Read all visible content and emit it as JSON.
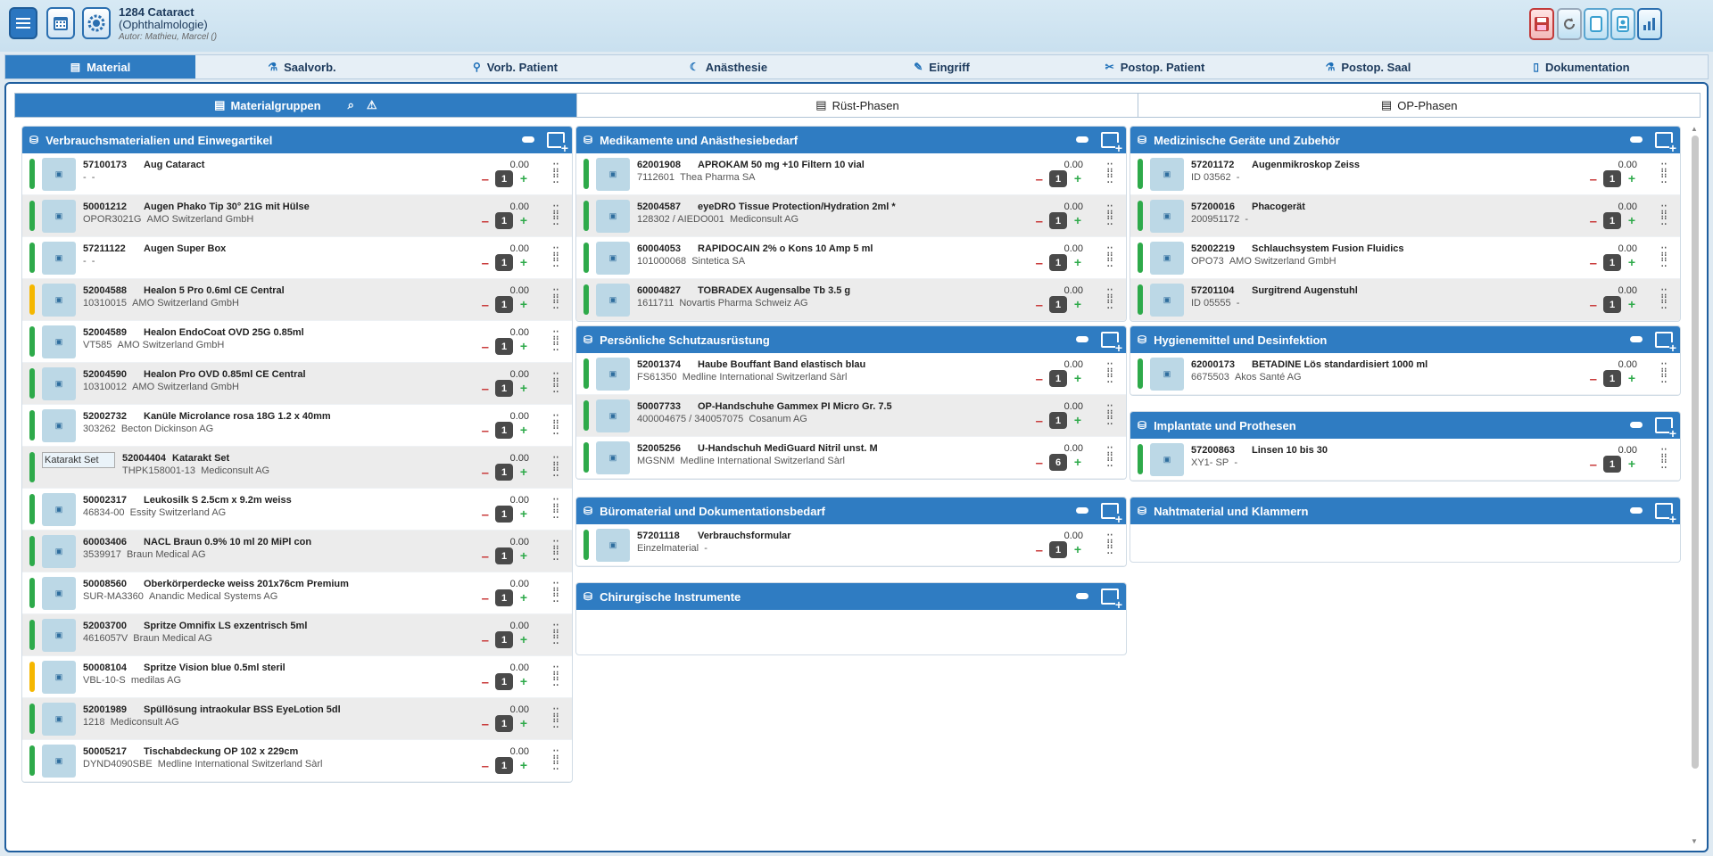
{
  "header": {
    "case_title": "1284 Cataract",
    "department": "(Ophthalmologie)",
    "author": "Autor: Mathieu, Marcel ()"
  },
  "main_tabs": [
    {
      "label": "Material",
      "icon": "archive-icon"
    },
    {
      "label": "Saalvorb.",
      "icon": "room-prep-icon"
    },
    {
      "label": "Vorb. Patient",
      "icon": "patient-prep-icon"
    },
    {
      "label": "Anästhesie",
      "icon": "moon-icon"
    },
    {
      "label": "Eingriff",
      "icon": "scalpel-icon"
    },
    {
      "label": "Postop. Patient",
      "icon": "tools-icon"
    },
    {
      "label": "Postop. Saal",
      "icon": "flask-icon"
    },
    {
      "label": "Dokumentation",
      "icon": "document-icon"
    }
  ],
  "sub_tabs": [
    {
      "label": "Materialgruppen"
    },
    {
      "label": "Rüst-Phasen"
    },
    {
      "label": "OP-Phasen"
    }
  ],
  "panels": {
    "verbrauch": {
      "title": "Verbrauchsmaterialien und Einwegartikel",
      "items": [
        {
          "code": "57100173",
          "name": "Aug Cataract",
          "ref": "-",
          "vendor": "-",
          "amount": "0.00",
          "qty": "1",
          "status": "green"
        },
        {
          "code": "50001212",
          "name": "Augen Phako Tip 30° 21G mit Hülse",
          "ref": "OPOR3021G",
          "vendor": "AMO Switzerland GmbH",
          "amount": "0.00",
          "qty": "1",
          "status": "green"
        },
        {
          "code": "57211122",
          "name": "Augen Super Box",
          "ref": "-",
          "vendor": "-",
          "amount": "0.00",
          "qty": "1",
          "status": "green"
        },
        {
          "code": "52004588",
          "name": "Healon 5 Pro 0.6ml CE Central",
          "ref": "10310015",
          "vendor": "AMO Switzerland GmbH",
          "amount": "0.00",
          "qty": "1",
          "status": "yellow"
        },
        {
          "code": "52004589",
          "name": "Healon EndoCoat OVD 25G 0.85ml",
          "ref": "VT585",
          "vendor": "AMO Switzerland GmbH",
          "amount": "0.00",
          "qty": "1",
          "status": "green"
        },
        {
          "code": "52004590",
          "name": "Healon Pro OVD 0.85ml CE Central",
          "ref": "10310012",
          "vendor": "AMO Switzerland GmbH",
          "amount": "0.00",
          "qty": "1",
          "status": "green"
        },
        {
          "code": "52002732",
          "name": "Kanüle Microlance rosa 18G 1.2 x 40mm",
          "ref": "303262",
          "vendor": "Becton Dickinson AG",
          "amount": "0.00",
          "qty": "1",
          "status": "green"
        },
        {
          "code": "52004404",
          "name": "Katarakt Set",
          "ref": "THPK158001-13",
          "vendor": "Mediconsult AG",
          "amount": "0.00",
          "qty": "1",
          "status": "green",
          "img_alt": "Katarakt Set"
        },
        {
          "code": "50002317",
          "name": "Leukosilk S 2.5cm x 9.2m weiss",
          "ref": "46834-00",
          "vendor": "Essity Switzerland AG",
          "amount": "0.00",
          "qty": "1",
          "status": "green"
        },
        {
          "code": "60003406",
          "name": "NACL Braun 0.9% 10 ml 20 MiPl con",
          "ref": "3539917",
          "vendor": "Braun Medical AG",
          "amount": "0.00",
          "qty": "1",
          "status": "green"
        },
        {
          "code": "50008560",
          "name": "Oberkörperdecke weiss 201x76cm Premium",
          "ref": "SUR-MA3360",
          "vendor": "Anandic Medical Systems AG",
          "amount": "0.00",
          "qty": "1",
          "status": "green"
        },
        {
          "code": "52003700",
          "name": "Spritze Omnifix LS exzentrisch 5ml",
          "ref": "4616057V",
          "vendor": "Braun Medical AG",
          "amount": "0.00",
          "qty": "1",
          "status": "green"
        },
        {
          "code": "50008104",
          "name": "Spritze Vision blue 0.5ml steril",
          "ref": "VBL-10-S",
          "vendor": "medilas AG",
          "amount": "0.00",
          "qty": "1",
          "status": "yellow"
        },
        {
          "code": "52001989",
          "name": "Spüllösung intraokular BSS EyeLotion 5dl",
          "ref": "1218",
          "vendor": "Mediconsult AG",
          "amount": "0.00",
          "qty": "1",
          "status": "green"
        },
        {
          "code": "50005217",
          "name": "Tischabdeckung OP 102 x 229cm",
          "ref": "DYND4090SBE",
          "vendor": "Medline International Switzerland Sàrl",
          "amount": "0.00",
          "qty": "1",
          "status": "green"
        }
      ]
    },
    "medikamente": {
      "title": "Medikamente und Anästhesiebedarf",
      "items": [
        {
          "code": "62001908",
          "name": "APROKAM 50 mg +10 Filtern 10 vial",
          "ref": "7112601",
          "vendor": "Thea Pharma SA",
          "amount": "0.00",
          "qty": "1",
          "status": "green"
        },
        {
          "code": "52004587",
          "name": "eyeDRO Tissue Protection/Hydration 2ml *",
          "ref": "128302 / AIEDO001",
          "vendor": "Mediconsult AG",
          "amount": "0.00",
          "qty": "1",
          "status": "green"
        },
        {
          "code": "60004053",
          "name": "RAPIDOCAIN 2% o Kons 10 Amp 5 ml",
          "ref": "101000068",
          "vendor": "Sintetica SA",
          "amount": "0.00",
          "qty": "1",
          "status": "green"
        },
        {
          "code": "60004827",
          "name": "TOBRADEX Augensalbe Tb 3.5 g",
          "ref": "1611711",
          "vendor": "Novartis Pharma Schweiz AG",
          "amount": "0.00",
          "qty": "1",
          "status": "green"
        }
      ]
    },
    "schutz": {
      "title": "Persönliche Schutzausrüstung",
      "items": [
        {
          "code": "52001374",
          "name": "Haube Bouffant Band elastisch blau",
          "ref": "FS61350",
          "vendor": "Medline International Switzerland Sàrl",
          "amount": "0.00",
          "qty": "1",
          "status": "green"
        },
        {
          "code": "50007733",
          "name": "OP-Handschuhe Gammex PI Micro Gr. 7.5",
          "ref": "400004675 / 340057075",
          "vendor": "Cosanum AG",
          "amount": "0.00",
          "qty": "1",
          "status": "green"
        },
        {
          "code": "52005256",
          "name": "U-Handschuh MediGuard Nitril unst. M",
          "ref": "MGSNM",
          "vendor": "Medline International Switzerland Sàrl",
          "amount": "0.00",
          "qty": "6",
          "status": "green"
        }
      ]
    },
    "buero": {
      "title": "Büromaterial und Dokumentationsbedarf",
      "items": [
        {
          "code": "57201118",
          "name": "Verbrauchsformular",
          "ref": "Einzelmaterial",
          "vendor": "-",
          "amount": "0.00",
          "qty": "1",
          "status": "green"
        }
      ]
    },
    "chirurgie": {
      "title": "Chirurgische Instrumente",
      "items": []
    },
    "geraete": {
      "title": "Medizinische Geräte und Zubehör",
      "items": [
        {
          "code": "57201172",
          "name": "Augenmikroskop Zeiss",
          "ref": "ID 03562",
          "vendor": "-",
          "amount": "0.00",
          "qty": "1",
          "status": "green"
        },
        {
          "code": "57200016",
          "name": "Phacogerät",
          "ref": "200951172",
          "vendor": "-",
          "amount": "0.00",
          "qty": "1",
          "status": "green"
        },
        {
          "code": "52002219",
          "name": "Schlauchsystem Fusion Fluidics",
          "ref": "OPO73",
          "vendor": "AMO Switzerland GmbH",
          "amount": "0.00",
          "qty": "1",
          "status": "green"
        },
        {
          "code": "57201104",
          "name": "Surgitrend Augenstuhl",
          "ref": "ID 05555",
          "vendor": "-",
          "amount": "0.00",
          "qty": "1",
          "status": "green"
        }
      ]
    },
    "hygiene": {
      "title": "Hygienemittel und Desinfektion",
      "items": [
        {
          "code": "62000173",
          "name": "BETADINE Lös standardisiert 1000 ml",
          "ref": "6675503",
          "vendor": "Akos Santé AG",
          "amount": "0.00",
          "qty": "1",
          "status": "green"
        }
      ]
    },
    "implantate": {
      "title": "Implantate und Prothesen",
      "items": [
        {
          "code": "57200863",
          "name": "Linsen 10 bis 30",
          "ref": "XY1- SP",
          "vendor": "-",
          "amount": "0.00",
          "qty": "1",
          "status": "green"
        }
      ]
    },
    "naht": {
      "title": "Nahtmaterial und Klammern",
      "items": []
    }
  },
  "colors": {
    "primary": "#2f7cc2",
    "status_green": "#2eaa4a",
    "status_yellow": "#f5b700",
    "minus_red": "#c93a3a"
  }
}
